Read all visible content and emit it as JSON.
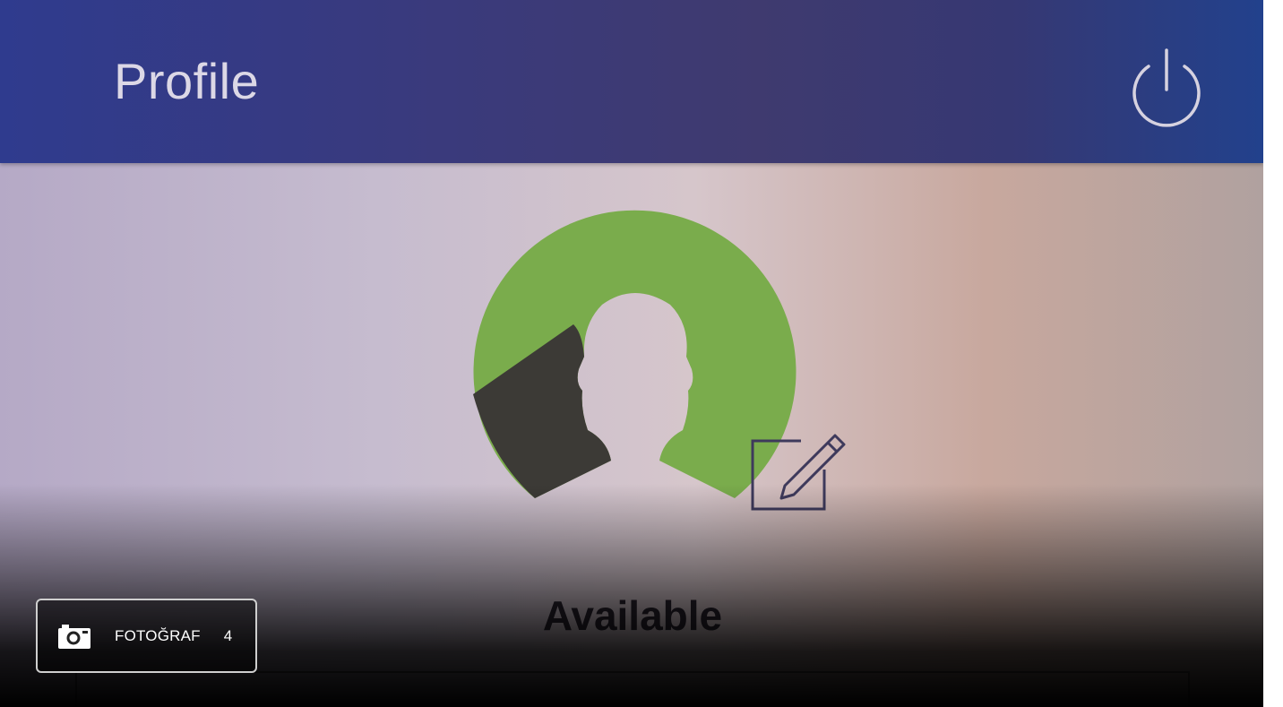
{
  "header": {
    "title": "Profile",
    "power_icon": "power-icon"
  },
  "profile": {
    "avatar_icon": "user-silhouette-icon",
    "edit_icon": "edit-pencil-icon",
    "status": "Available"
  },
  "photo_badge": {
    "icon": "camera-icon",
    "label": "FOTOĞRAF",
    "count": "4"
  },
  "colors": {
    "app_bar": "#3a3a7c",
    "avatar_green": "#7aac4c",
    "avatar_dark": "#3c3a36",
    "background": "#cbbfcc"
  }
}
